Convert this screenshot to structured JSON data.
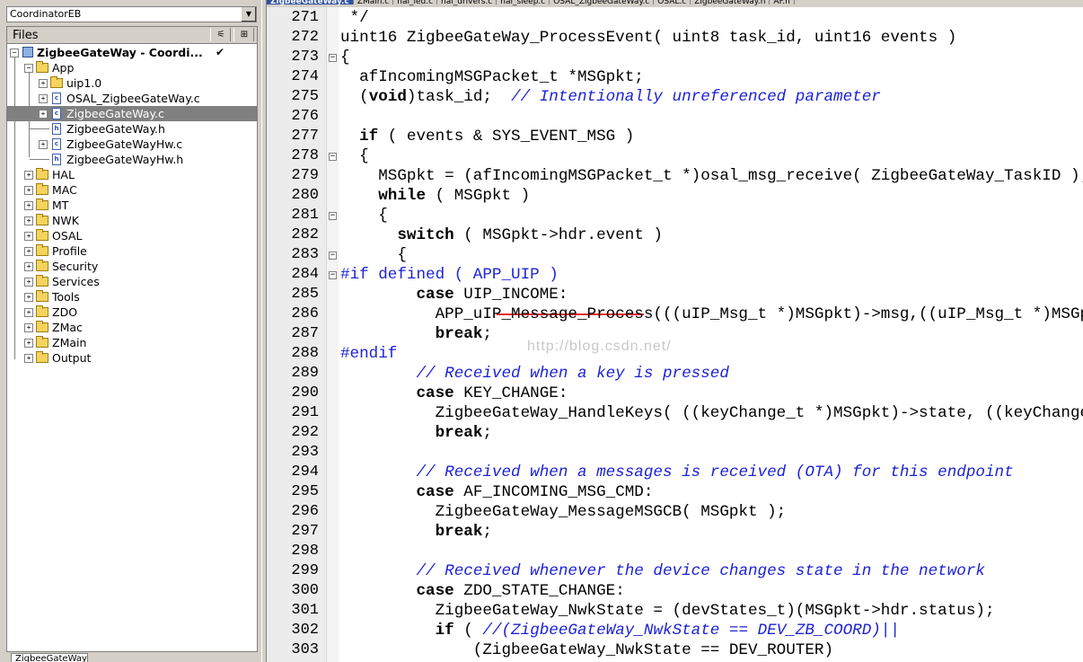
{
  "config": {
    "selected": "CoordinatorEB"
  },
  "files_panel": {
    "header": "Files"
  },
  "tree": [
    {
      "label": "ZigbeeGateWay - Coordi...",
      "check": "✔"
    },
    {
      "label": "App"
    },
    {
      "label": "uip1.0"
    },
    {
      "label": "OSAL_ZigbeeGateWay.c"
    },
    {
      "label": "ZigbeeGateWay.c"
    },
    {
      "label": "ZigbeeGateWay.h"
    },
    {
      "label": "ZigbeeGateWayHw.c"
    },
    {
      "label": "ZigbeeGateWayHw.h"
    },
    {
      "label": "HAL"
    },
    {
      "label": "MAC"
    },
    {
      "label": "MT"
    },
    {
      "label": "NWK"
    },
    {
      "label": "OSAL"
    },
    {
      "label": "Profile"
    },
    {
      "label": "Security"
    },
    {
      "label": "Services"
    },
    {
      "label": "Tools"
    },
    {
      "label": "ZDO"
    },
    {
      "label": "ZMac"
    },
    {
      "label": "ZMain"
    },
    {
      "label": "Output"
    }
  ],
  "bottom_tab": "ZigbeeGateWay",
  "editor_tabs": [
    "ZigbeeGateWay.c",
    "ZMain.c",
    "hal_led.c",
    "hal_drivers.c",
    "hal_sleep.c",
    "OSAL_ZigbeeGateWay.c",
    "OSAL.c",
    "ZigbeeGateWay.h",
    "AF.h"
  ],
  "watermark": "http://blog.csdn.net/",
  "lines": [
    {
      "num": "271",
      "text": " */"
    },
    {
      "num": "272",
      "text": "uint16 ZigbeeGateWay_ProcessEvent( uint8 task_id, uint16 events )"
    },
    {
      "num": "273",
      "text": "{"
    },
    {
      "num": "274",
      "text": "  afIncomingMSGPacket_t *MSGpkt;"
    },
    {
      "num": "275",
      "text": "  (void)task_id;  // Intentionally unreferenced parameter"
    },
    {
      "num": "276",
      "text": ""
    },
    {
      "num": "277",
      "text": "  if ( events & SYS_EVENT_MSG )"
    },
    {
      "num": "278",
      "text": "  {"
    },
    {
      "num": "279",
      "text": "    MSGpkt = (afIncomingMSGPacket_t *)osal_msg_receive( ZigbeeGateWay_TaskID );"
    },
    {
      "num": "280",
      "text": "    while ( MSGpkt )"
    },
    {
      "num": "281",
      "text": "    {"
    },
    {
      "num": "282",
      "text": "      switch ( MSGpkt->hdr.event )"
    },
    {
      "num": "283",
      "text": "      {"
    },
    {
      "num": "284",
      "text": "#if defined ( APP_UIP )"
    },
    {
      "num": "285",
      "text": "        case UIP_INCOME:"
    },
    {
      "num": "286",
      "text": "          APP_uIP_Message_Process(((uIP_Msg_t *)MSGpkt)->msg,((uIP_Msg_t *)MSGpkt)->len);"
    },
    {
      "num": "287",
      "text": "          break;"
    },
    {
      "num": "288",
      "text": "#endif"
    },
    {
      "num": "289",
      "text": "        // Received when a key is pressed"
    },
    {
      "num": "290",
      "text": "        case KEY_CHANGE:"
    },
    {
      "num": "291",
      "text": "          ZigbeeGateWay_HandleKeys( ((keyChange_t *)MSGpkt)->state, ((keyChange_t *)MSGpkt)->keys );"
    },
    {
      "num": "292",
      "text": "          break;"
    },
    {
      "num": "293",
      "text": ""
    },
    {
      "num": "294",
      "text": "        // Received when a messages is received (OTA) for this endpoint"
    },
    {
      "num": "295",
      "text": "        case AF_INCOMING_MSG_CMD:"
    },
    {
      "num": "296",
      "text": "          ZigbeeGateWay_MessageMSGCB( MSGpkt );"
    },
    {
      "num": "297",
      "text": "          break;"
    },
    {
      "num": "298",
      "text": ""
    },
    {
      "num": "299",
      "text": "        // Received whenever the device changes state in the network"
    },
    {
      "num": "300",
      "text": "        case ZDO_STATE_CHANGE:"
    },
    {
      "num": "301",
      "text": "          ZigbeeGateWay_NwkState = (devStates_t)(MSGpkt->hdr.status);"
    },
    {
      "num": "302",
      "text": "          if ( //(ZigbeeGateWay_NwkState == DEV_ZB_COORD)||"
    },
    {
      "num": "303",
      "text": "              (ZigbeeGateWay_NwkState == DEV_ROUTER)"
    }
  ]
}
